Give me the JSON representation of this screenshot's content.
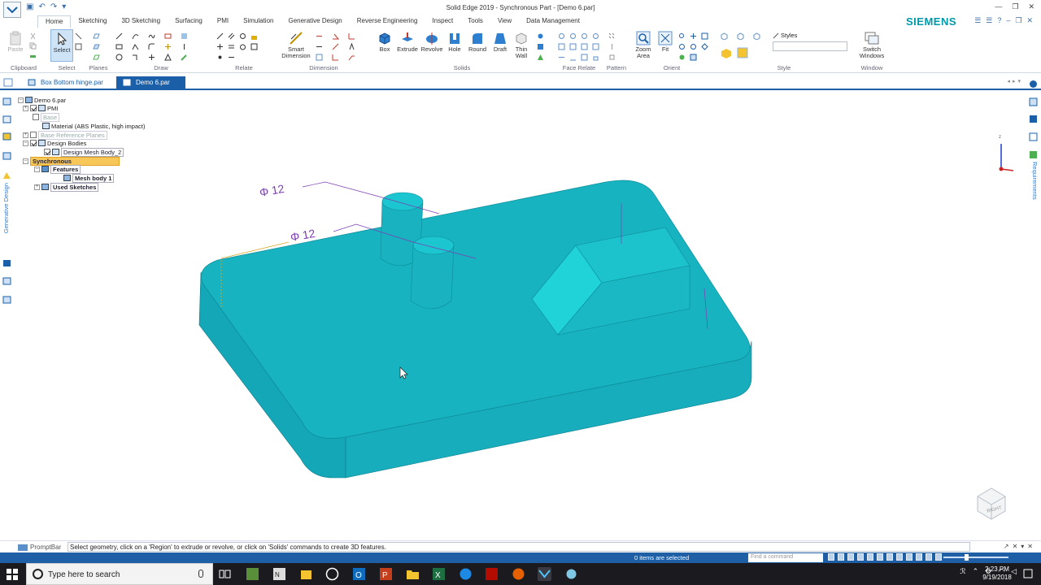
{
  "window": {
    "title": "Solid Edge 2019 - Synchronous Part - [Demo 6.par]",
    "brand": "SIEMENS"
  },
  "ribbon": {
    "tabs": [
      "Home",
      "Sketching",
      "3D Sketching",
      "Surfacing",
      "PMI",
      "Simulation",
      "Generative Design",
      "Reverse Engineering",
      "Inspect",
      "Tools",
      "View",
      "Data Management"
    ],
    "groups": {
      "clipboard": "Clipboard",
      "select": "Select",
      "planes": "Planes",
      "draw": "Draw",
      "relate": "Relate",
      "dimension": "Dimension",
      "solids": "Solids",
      "face_relate": "Face Relate",
      "pattern": "Pattern",
      "orient": "Orient",
      "style": "Style",
      "window": "Window"
    },
    "tools": {
      "paste": "Paste",
      "select": "Select",
      "smart_dimension_1": "Smart",
      "smart_dimension_2": "Dimension",
      "box": "Box",
      "extrude": "Extrude",
      "revolve": "Revolve",
      "hole": "Hole",
      "round": "Round",
      "draft": "Draft",
      "thin_wall_1": "Thin",
      "thin_wall_2": "Wall",
      "zoom_area_1": "Zoom",
      "zoom_area_2": "Area",
      "fit": "Fit",
      "styles": "Styles",
      "switch_windows_1": "Switch",
      "switch_windows_2": "Windows"
    }
  },
  "document_tabs": [
    {
      "label": "Box Bottom hinge.par"
    },
    {
      "label": "Demo 6.par"
    }
  ],
  "tree": {
    "root": "Demo 6.par",
    "pmi": "PMI",
    "base": "Base",
    "material": "Material (ABS Plastic, high impact)",
    "base_planes": "Base Reference Planes",
    "design_bodies": "Design Bodies",
    "design_mesh_body": "Design Mesh Body_2",
    "synchronous": "Synchronous",
    "features": "Features",
    "mesh_body": "Mesh body 1",
    "used_sketches": "Used Sketches"
  },
  "viewport": {
    "dim_1": "Φ 12",
    "dim_2": "Φ 12",
    "viewcube_label": "RIGHT",
    "part_color": "#18b3c0"
  },
  "side_labels": {
    "generative_design": "Generative Design",
    "requirements": "Requirements"
  },
  "prompt": {
    "label": "PromptBar",
    "text": "Select geometry, click on a 'Region' to extrude or revolve, or click on 'Solids' commands to create 3D features."
  },
  "status": {
    "selected": "0 items are selected",
    "find_placeholder": "Find a command"
  },
  "taskbar": {
    "search_placeholder": "Type here to search",
    "time": "2:23 PM",
    "date": "9/19/2018"
  }
}
